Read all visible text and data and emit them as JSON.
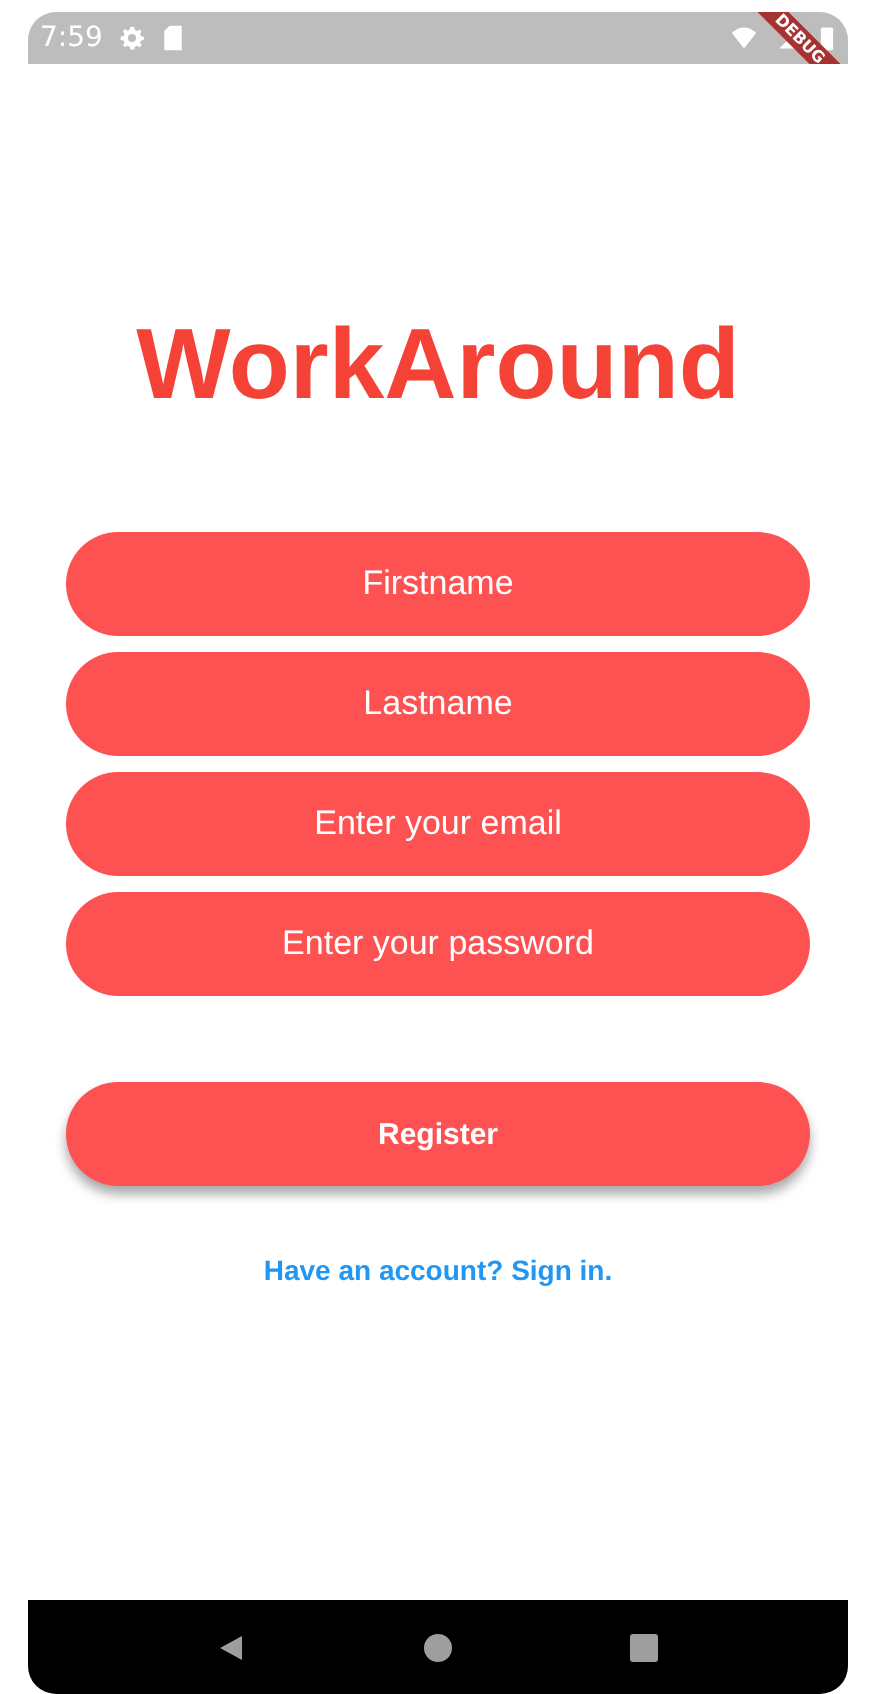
{
  "status_bar": {
    "time": "7:59"
  },
  "debug_banner": "DEBUG",
  "title": "WorkAround",
  "fields": [
    {
      "placeholder": "Firstname"
    },
    {
      "placeholder": "Lastname"
    },
    {
      "placeholder": "Enter your email"
    },
    {
      "placeholder": "Enter your password"
    }
  ],
  "register_button": "Register",
  "sign_in_link": "Have an account? Sign in."
}
